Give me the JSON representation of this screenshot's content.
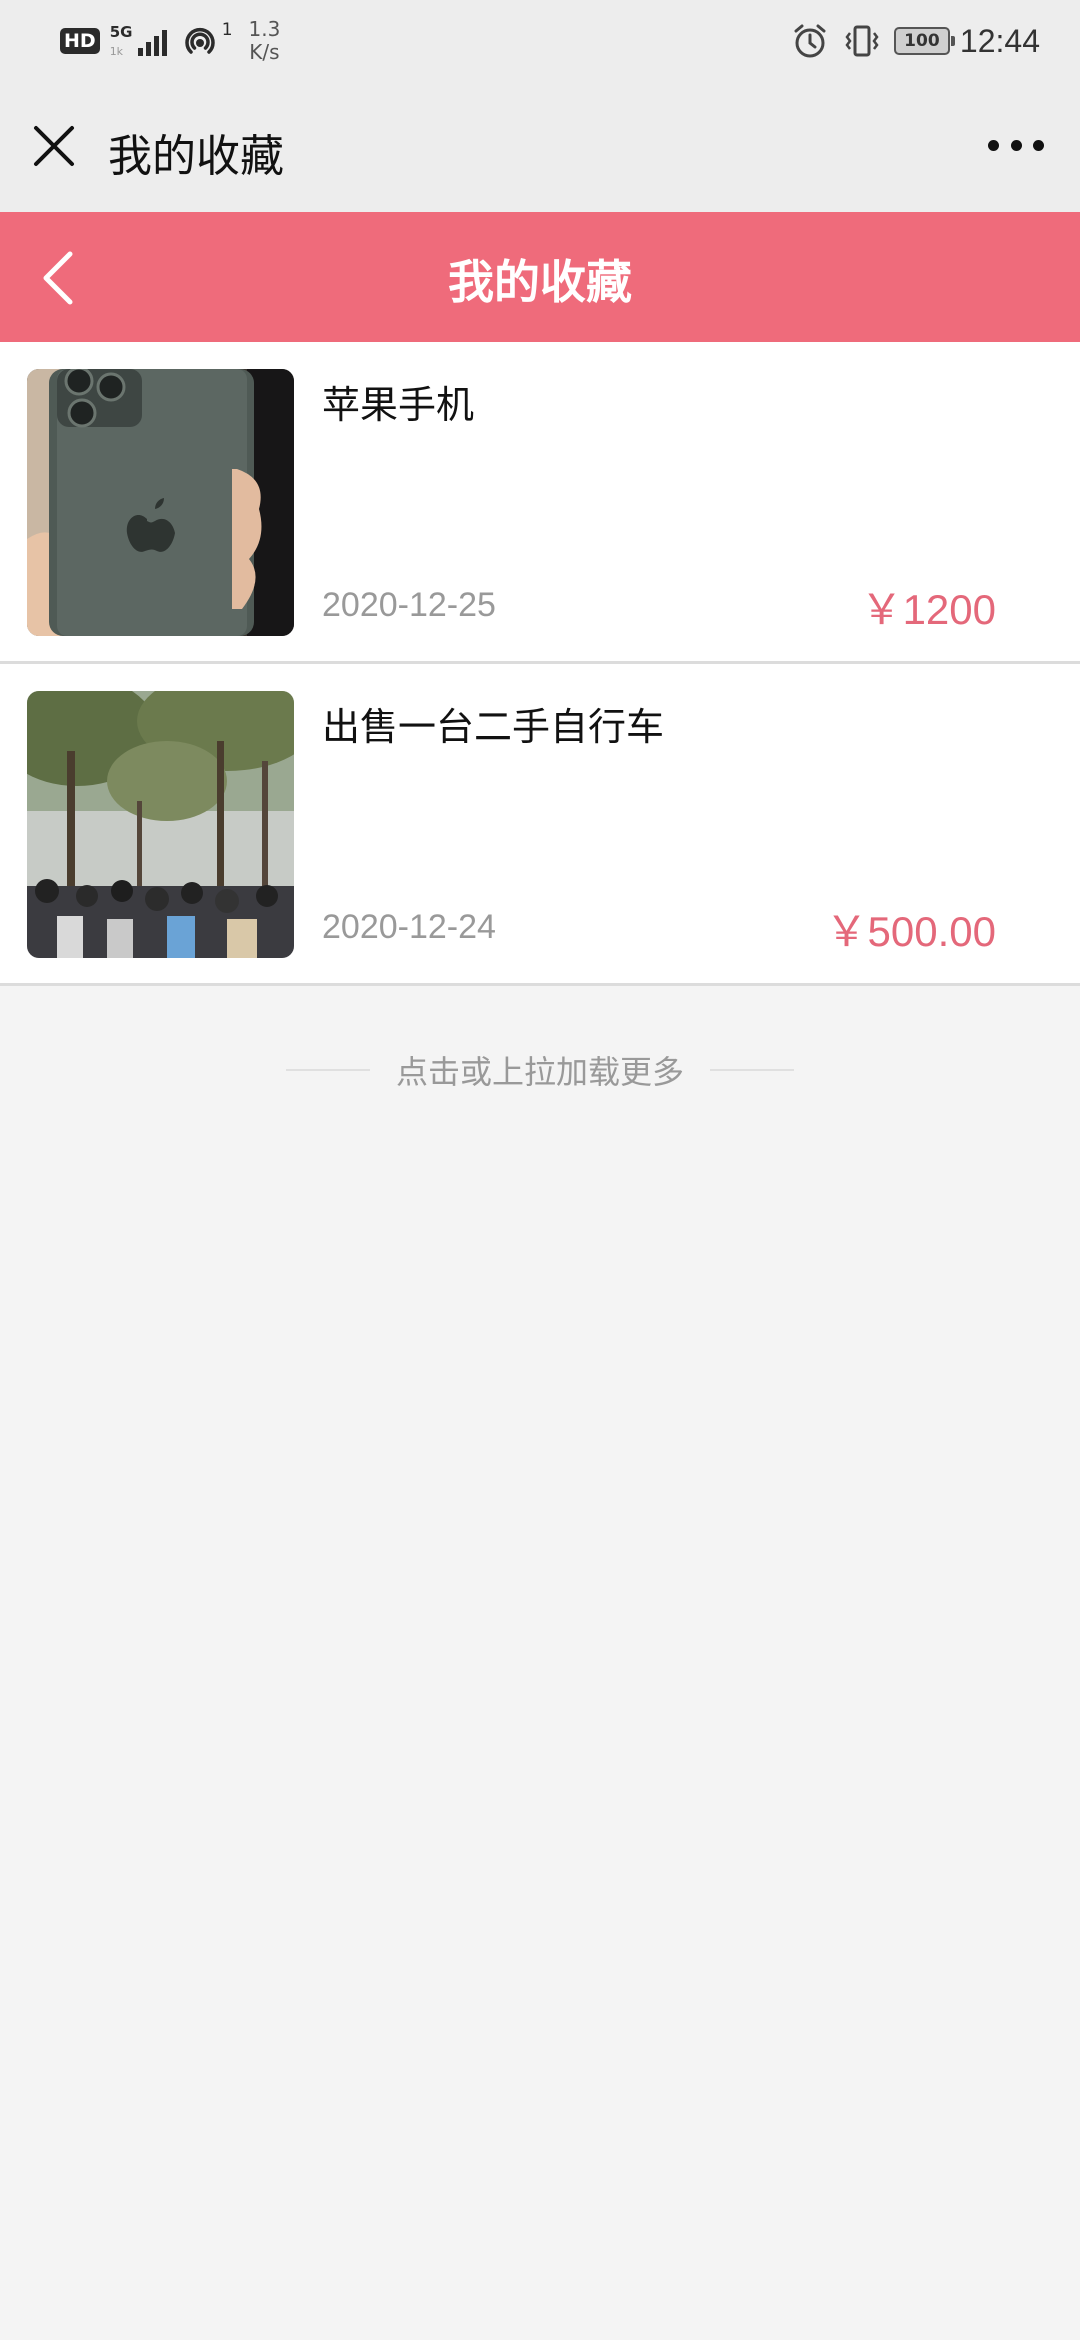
{
  "status_bar": {
    "hd": "HD",
    "network": "5G",
    "network_sub": "1k",
    "hotspot_count": "1",
    "speed_value": "1.3",
    "speed_unit": "K/s",
    "battery": "100",
    "time": "12:44",
    "icons": [
      "signal-icon",
      "hotspot-icon",
      "alarm-icon",
      "vibrate-icon",
      "battery-icon"
    ]
  },
  "wechat_bar": {
    "title": "我的收藏",
    "close_icon": "close-icon",
    "more_icon": "more-dots-icon"
  },
  "header": {
    "title": "我的收藏",
    "back_icon": "chevron-left-icon",
    "color": "#ef6b7b"
  },
  "items": [
    {
      "title": "苹果手机",
      "date": "2020-12-25",
      "price": "￥1200"
    },
    {
      "title": "出售一台二手自行车",
      "date": "2020-12-24",
      "price": "￥500.00"
    }
  ],
  "load_more": "点击或上拉加载更多",
  "colors": {
    "accent": "#ef6b7b",
    "price": "#e4687a",
    "background": "#f4f4f4"
  }
}
